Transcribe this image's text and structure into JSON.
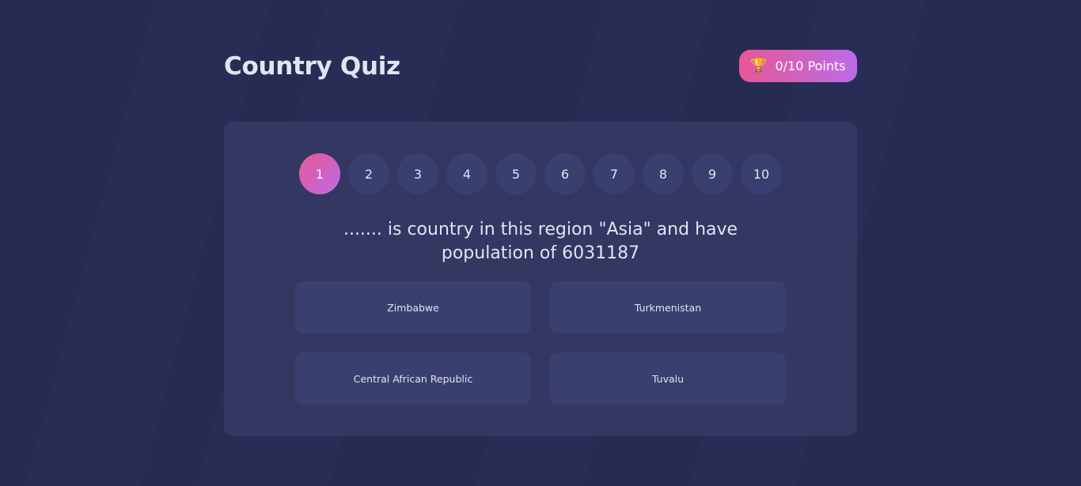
{
  "header": {
    "title": "Country Quiz",
    "points_label": "0/10 Points",
    "points_icon": "trophy-icon",
    "accent_gradient": [
      "#e65895",
      "#bc6be8"
    ]
  },
  "quiz": {
    "current_question": 1,
    "steps": [
      "1",
      "2",
      "3",
      "4",
      "5",
      "6",
      "7",
      "8",
      "9",
      "10"
    ],
    "question": "....... is country in this region \"Asia\" and have population of 6031187",
    "answers": [
      "Zimbabwe",
      "Turkmenistan",
      "Central African Republic",
      "Tuvalu"
    ]
  },
  "colors": {
    "background": "#252a4f",
    "card": "#333762",
    "tile": "#393f6e",
    "text": "#e2e4f3"
  }
}
